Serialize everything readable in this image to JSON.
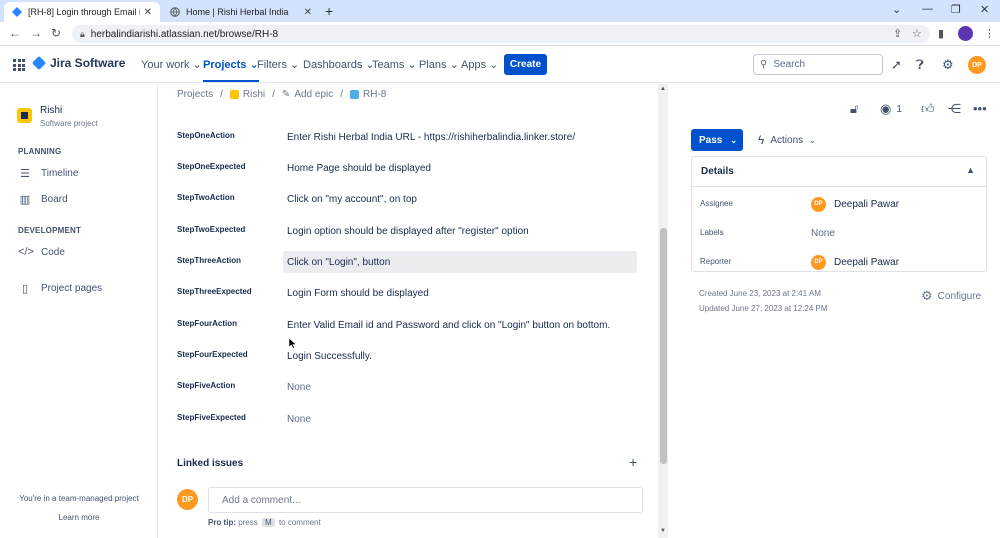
{
  "browser": {
    "tabs": [
      {
        "title": "[RH-8] Login through Email id ar",
        "active": true
      },
      {
        "title": "Home | Rishi Herbal India",
        "active": false
      }
    ],
    "url": "herbalindiarishi.atlassian.net/browse/RH-8"
  },
  "header": {
    "product": "Jira Software",
    "nav": [
      "Your work",
      "Projects",
      "Filters",
      "Dashboards",
      "Teams",
      "Plans",
      "Apps"
    ],
    "create_label": "Create",
    "search_placeholder": "Search",
    "user_initials": "DP",
    "accent": "#0052cc"
  },
  "sidebar": {
    "project_name": "Rishi",
    "project_type": "Software project",
    "planning_heading": "PLANNING",
    "planning_items": [
      "Timeline",
      "Board"
    ],
    "development_heading": "DEVELOPMENT",
    "development_items": [
      "Code"
    ],
    "project_pages": "Project pages",
    "team_note": "You're in a team-managed project",
    "learn_more": "Learn more"
  },
  "breadcrumb": {
    "projects": "Projects",
    "project": "Rishi",
    "add_epic": "Add epic",
    "issue_key": "RH-8"
  },
  "fields": [
    {
      "label": "StepOneAction",
      "value": "Enter Rishi Herbal India URL - https://rishiherbalindia.linker.store/"
    },
    {
      "label": "StepOneExpected",
      "value": "Home Page should be displayed"
    },
    {
      "label": "StepTwoAction",
      "value": "Click on \"my account\", on top"
    },
    {
      "label": "StepTwoExpected",
      "value": "Login option should be displayed after \"register\" option"
    },
    {
      "label": "StepThreeAction",
      "value": "Click on \"Login\", button"
    },
    {
      "label": "StepThreeExpected",
      "value": "Login Form should be displayed"
    },
    {
      "label": "StepFourAction",
      "value": "Enter Valid Email id and Password and click on \"Login\" button on bottom."
    },
    {
      "label": "StepFourExpected",
      "value": "Login Successfully."
    },
    {
      "label": "StepFiveAction",
      "value": "None"
    },
    {
      "label": "StepFiveExpected",
      "value": "None"
    }
  ],
  "linked_issues": "Linked issues",
  "comment": {
    "placeholder": "Add a comment...",
    "user_initials": "DP",
    "protip_prefix": "Pro tip:",
    "protip_press": "press",
    "protip_key": "M",
    "protip_suffix": "to comment"
  },
  "right_panel": {
    "watch_count": "1",
    "status": "Pass",
    "actions_label": "Actions",
    "details_heading": "Details",
    "assignee_label": "Assignee",
    "assignee": "Deepali Pawar",
    "assignee_initials": "DP",
    "labels_label": "Labels",
    "labels_value": "None",
    "reporter_label": "Reporter",
    "reporter": "Deepali Pawar",
    "reporter_initials": "DP",
    "created": "Created June 23, 2023 at 2:41 AM",
    "updated": "Updated June 27, 2023 at 12:24 PM",
    "configure": "Configure"
  }
}
